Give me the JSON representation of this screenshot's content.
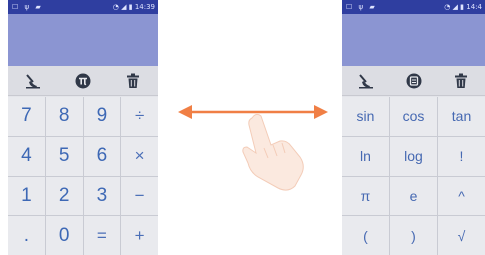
{
  "left_phone": {
    "status": {
      "left_icons": "☐ ψ ▰",
      "time": "14:39"
    },
    "keys": [
      {
        "label": "7",
        "kind": "num"
      },
      {
        "label": "8",
        "kind": "num"
      },
      {
        "label": "9",
        "kind": "num"
      },
      {
        "label": "÷",
        "kind": "op"
      },
      {
        "label": "4",
        "kind": "num"
      },
      {
        "label": "5",
        "kind": "num"
      },
      {
        "label": "6",
        "kind": "num"
      },
      {
        "label": "×",
        "kind": "op"
      },
      {
        "label": "1",
        "kind": "num"
      },
      {
        "label": "2",
        "kind": "num"
      },
      {
        "label": "3",
        "kind": "num"
      },
      {
        "label": "−",
        "kind": "op"
      },
      {
        "label": ".",
        "kind": "num"
      },
      {
        "label": "0",
        "kind": "num"
      },
      {
        "label": "=",
        "kind": "op"
      },
      {
        "label": "+",
        "kind": "op"
      }
    ]
  },
  "right_phone": {
    "status": {
      "left_icons": "☐ ψ ▰",
      "time": "14:4"
    },
    "keys": [
      {
        "label": "sin"
      },
      {
        "label": "cos"
      },
      {
        "label": "tan"
      },
      {
        "label": "ln"
      },
      {
        "label": "log"
      },
      {
        "label": "!"
      },
      {
        "label": "π"
      },
      {
        "label": "e"
      },
      {
        "label": "^"
      },
      {
        "label": "("
      },
      {
        "label": ")"
      },
      {
        "label": "√"
      }
    ]
  },
  "icons": {
    "clear_history": "clear-history-icon",
    "pi_toggle": "pi-mode-icon",
    "number_toggle": "number-mode-icon",
    "delete": "trash-icon",
    "swipe_arrow": "double-arrow-icon",
    "swipe_hand": "swipe-hand-icon"
  },
  "colors": {
    "status_bar": "#2f3ea0",
    "display": "#8b95d2",
    "key_background": "#e9eaee",
    "key_text": "#3d68b5",
    "arrow": "#f07f45"
  }
}
